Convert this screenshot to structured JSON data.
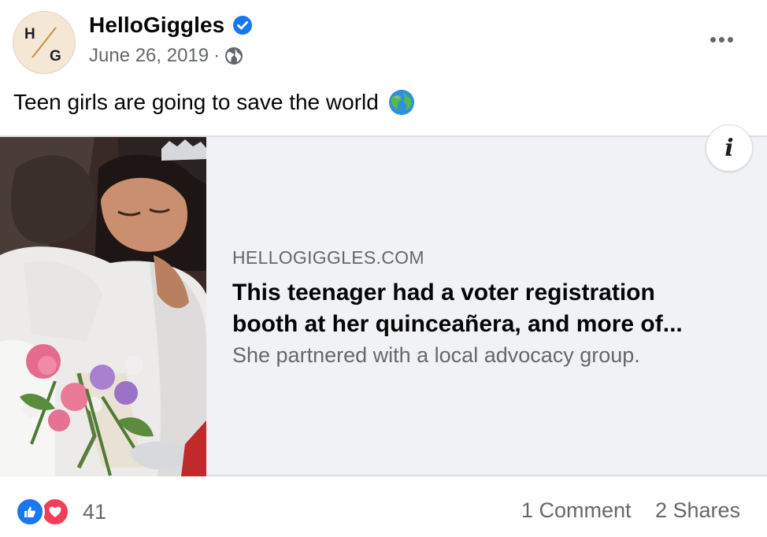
{
  "post": {
    "author": "HelloGiggles",
    "avatar_letters": [
      "H",
      "G"
    ],
    "date": "June 26, 2019",
    "separator": "·",
    "audience_icon": "globe-icon",
    "text": "Teen girls are going to save the world",
    "text_emoji": "earth-globe-emoji",
    "more_icon": "more-options-icon"
  },
  "link_card": {
    "domain": "HELLOGIGGLES.COM",
    "title_line1": "This teenager had a voter registration",
    "title_line2": "booth at her quinceañera, and more of...",
    "description": "She partnered with a local advocacy group.",
    "info_label": "i"
  },
  "footer": {
    "reaction_icons": [
      "like-reaction-icon",
      "love-reaction-icon"
    ],
    "reaction_count": "41",
    "comments": "1 Comment",
    "shares": "2 Shares"
  },
  "colors": {
    "brand_blue": "#1877f2",
    "love_red": "#f33e58",
    "secondary_text": "#65676b",
    "card_bg": "#f0f2f5"
  }
}
